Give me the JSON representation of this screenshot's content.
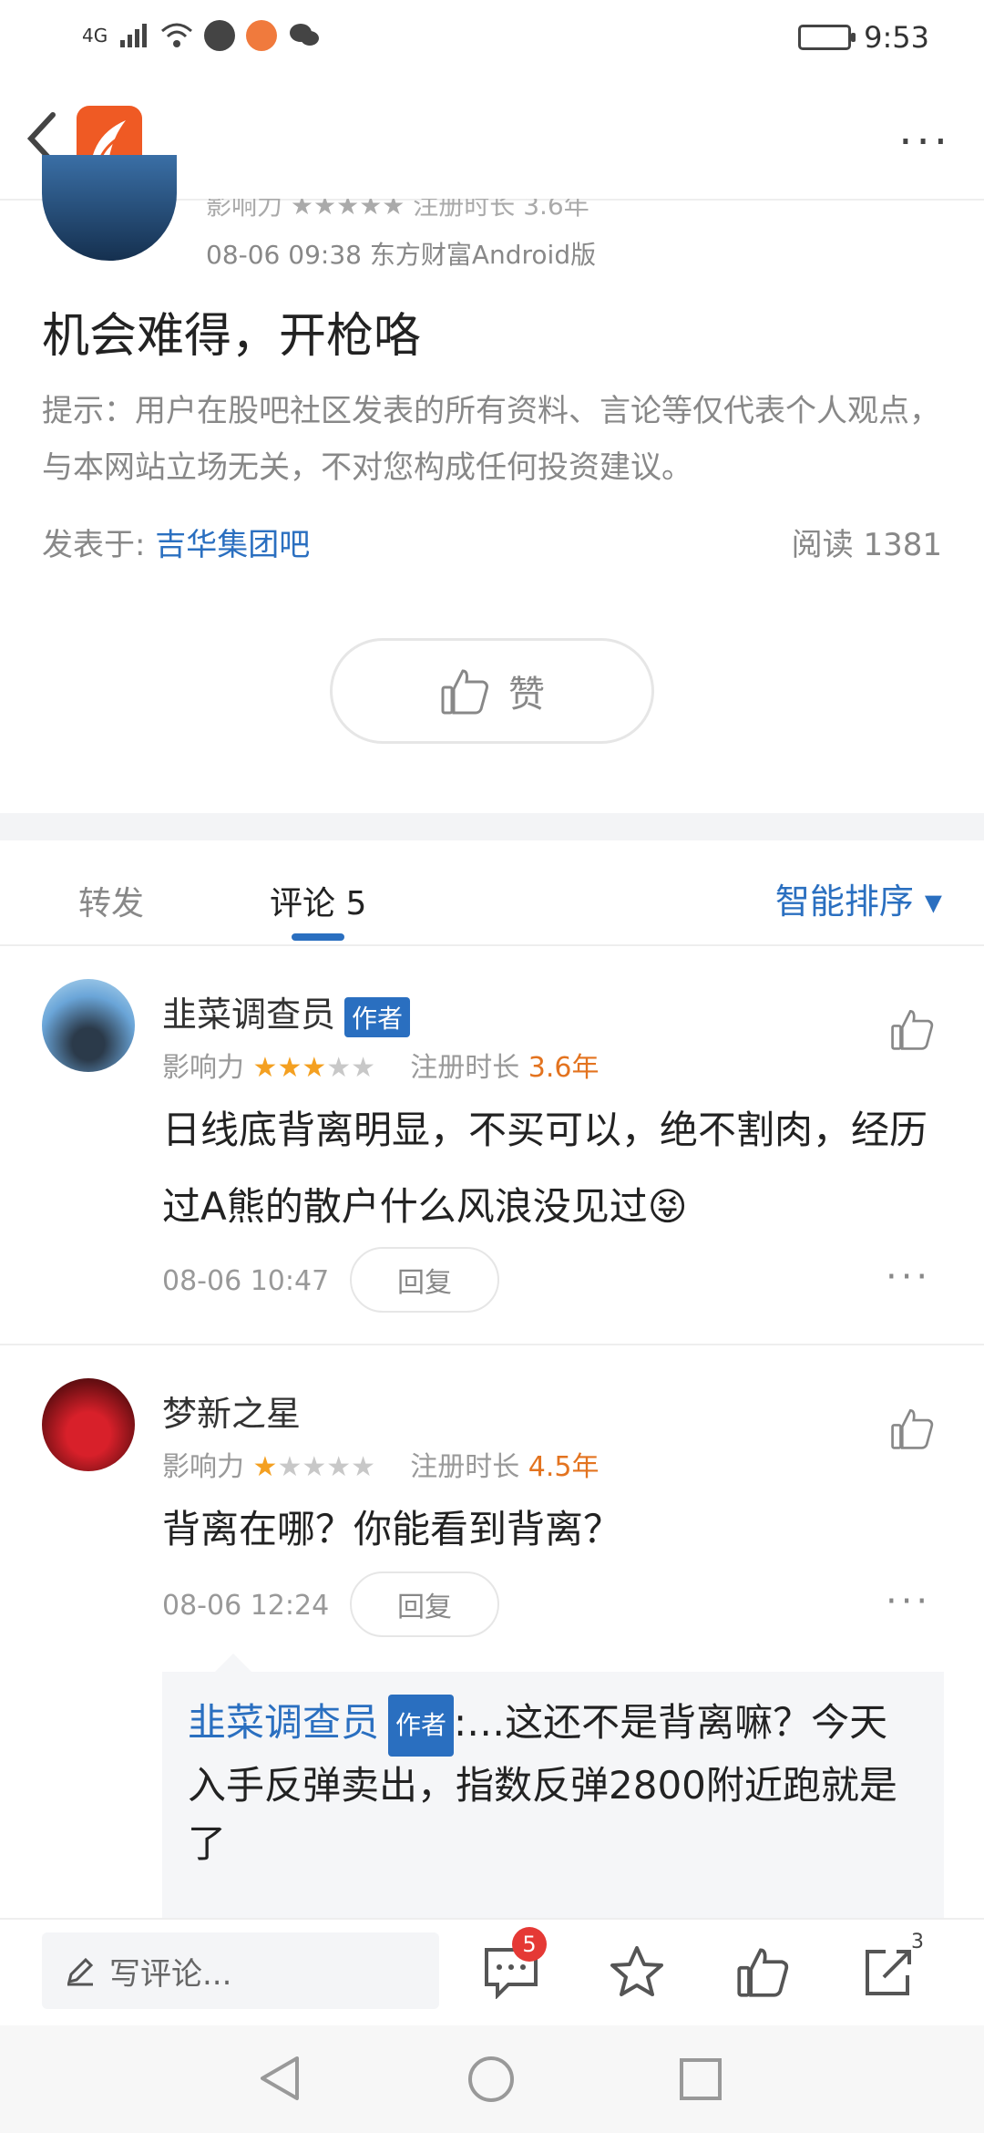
{
  "status_bar": {
    "signal_label": "4G",
    "time": "9:53"
  },
  "header": {
    "back_icon": "back-chevron-icon",
    "app_icon": "eastmoney-logo",
    "more_icon": "more-dots-icon"
  },
  "post": {
    "hidden_meta": "影响力 ★★★★★ 注册时长 3.6年",
    "meta": "08-06 09:38 东方财富Android版",
    "title": "机会难得，开枪咯",
    "tip": "提示：用户在股吧社区发表的所有资料、言论等仅代表个人观点，与本网站立场无关，不对您构成任何投资建议。",
    "posted_in_label": "发表于:",
    "posted_in_link": "吉华集团吧",
    "reads": "阅读 1381",
    "like_label": "赞"
  },
  "tabs": {
    "items": [
      {
        "label": "转发"
      },
      {
        "label": "评论 5"
      }
    ],
    "sort_label": "智能排序 ▾"
  },
  "comments": [
    {
      "name": "韭菜调查员",
      "badge": "作者",
      "influence_label": "影响力",
      "stars_on": 3,
      "stars_total": 5,
      "reg_label": "注册时长",
      "reg_years": "3.6年",
      "text": "日线底背离明显，不买可以，绝不割肉，经历过A熊的散户什么风浪没见过😝",
      "time": "08-06 10:47",
      "reply": "回复"
    },
    {
      "name": "梦新之星",
      "influence_label": "影响力",
      "stars_on": 1,
      "stars_total": 5,
      "reg_label": "注册时长",
      "reg_years": "4.5年",
      "text": "背离在哪？你能看到背离？",
      "time": "08-06 12:24",
      "reply": "回复",
      "quote": {
        "name": "韭菜调查员",
        "badge": "作者",
        "text": ":…这还不是背离嘛？今天入手反弹卖出，指数反弹2800附近跑就是了"
      }
    }
  ],
  "bottom_bar": {
    "write_placeholder": "写评论...",
    "comment_count": "5",
    "share_count": "3"
  },
  "colors": {
    "accent": "#2a6fc0",
    "star": "#f4a021",
    "years": "#e3731f",
    "badge_red": "#e53935",
    "logo": "#ef5a24"
  }
}
